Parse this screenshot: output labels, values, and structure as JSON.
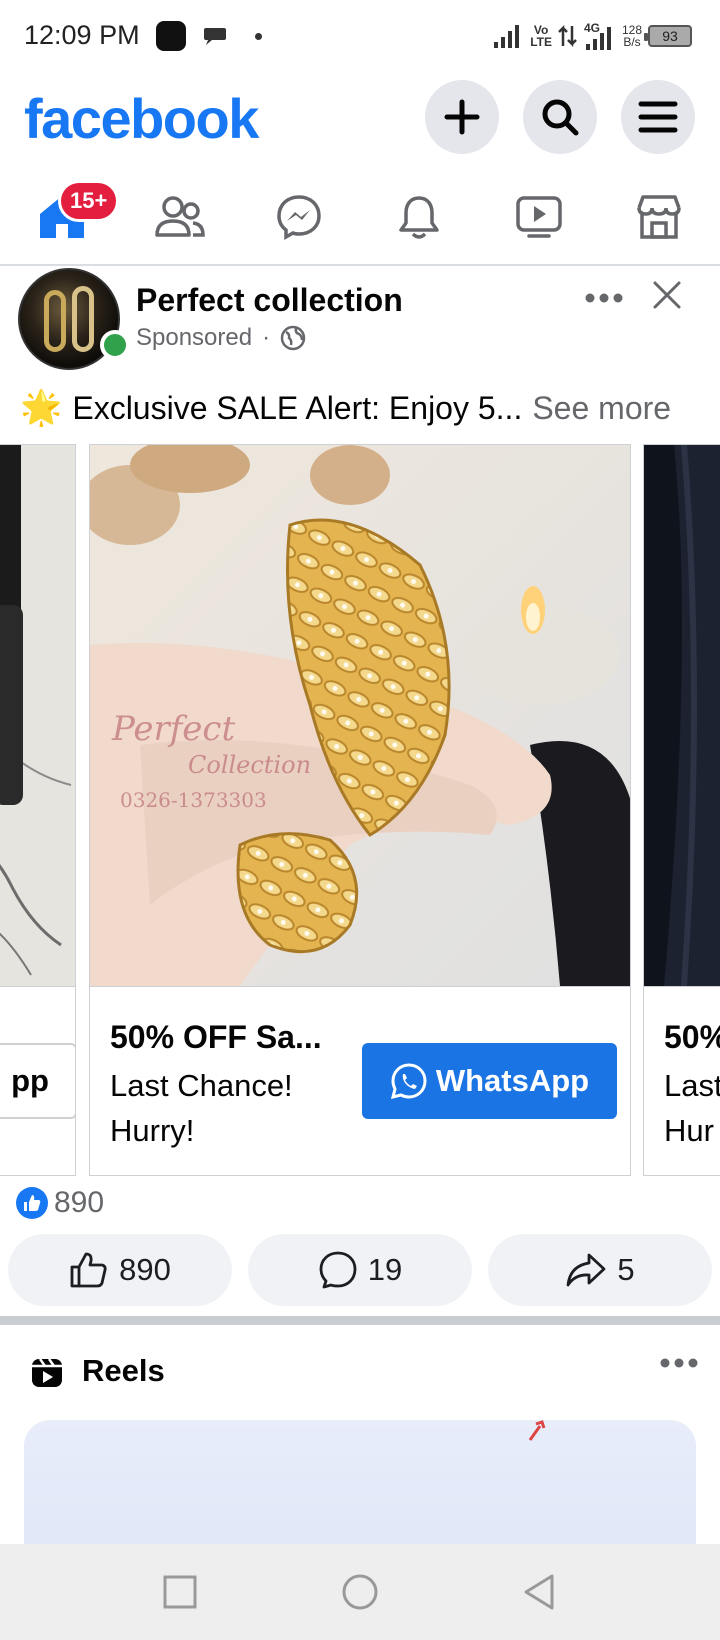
{
  "status_bar": {
    "time": "12:09 PM",
    "network_top": "Vo",
    "network_bottom": "LTE",
    "gen": "4G",
    "speed_top": "128",
    "speed_bottom": "B/s",
    "battery": "93"
  },
  "header": {
    "logo": "facebook",
    "icons": [
      "plus-icon",
      "search-icon",
      "menu-icon"
    ]
  },
  "tabs": {
    "home_badge": "15+",
    "items": [
      "home-icon",
      "friends-icon",
      "messenger-icon",
      "notifications-icon",
      "video-icon",
      "marketplace-icon"
    ]
  },
  "post": {
    "page_name": "Perfect collection",
    "sponsored": "Sponsored",
    "dot": "·",
    "caption_emoji": "🌟",
    "caption": "Exclusive SALE Alert: Enjoy 5...",
    "see_more": "See more",
    "watermark_line1": "Perfect",
    "watermark_line2": "Collection",
    "watermark_phone": "0326-1373303",
    "cards": {
      "left_partial_button": "pp",
      "main": {
        "title": "50% OFF Sa...",
        "subtitle": "Last Chance! Hurry!",
        "button": "WhatsApp"
      },
      "right_partial": {
        "title": "50%",
        "line1": "Last",
        "line2": "Hur"
      }
    },
    "reaction_count": "890",
    "actions": {
      "like": "890",
      "comment": "19",
      "share": "5"
    }
  },
  "reels": {
    "title": "Reels"
  },
  "colors": {
    "brand": "#1877f2",
    "badge": "#e41e3f",
    "cta": "#1b74e4",
    "online": "#31a24c"
  }
}
